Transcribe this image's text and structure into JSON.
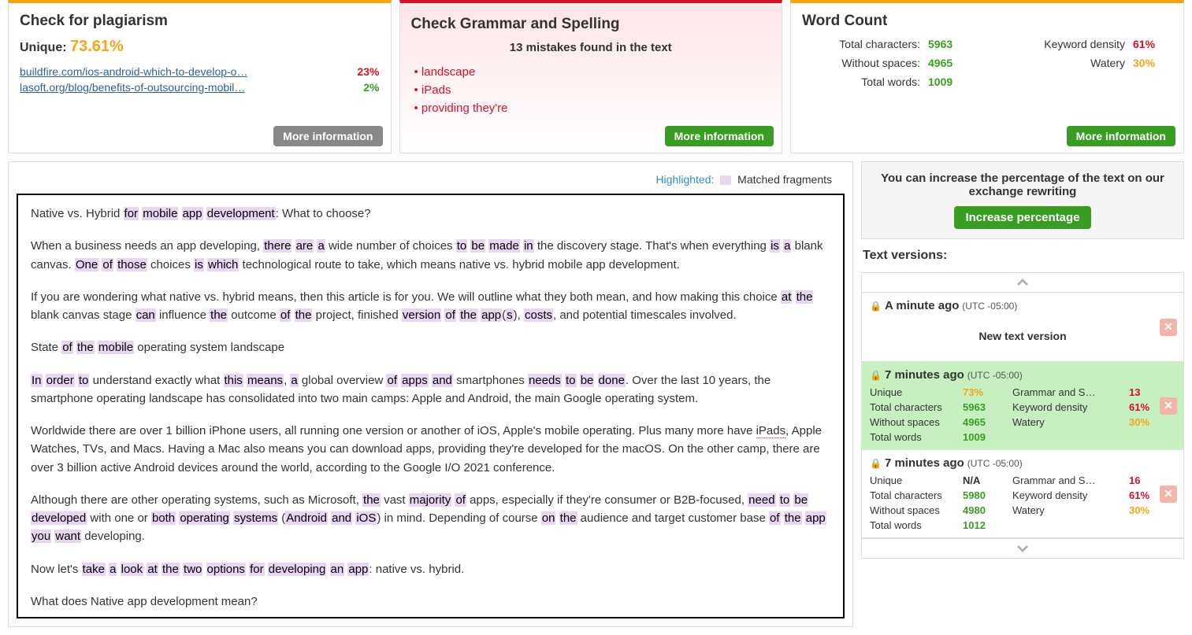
{
  "plagiarism": {
    "title": "Check for plagiarism",
    "unique_label": "Unique:",
    "unique_value": "73.61%",
    "sources": [
      {
        "url": "buildfire.com/ios-android-which-to-develop-o…",
        "pct": "23%",
        "tone": "red"
      },
      {
        "url": "lasoft.org/blog/benefits-of-outsourcing-mobil…",
        "pct": "2%",
        "tone": "green"
      }
    ],
    "more": "More information"
  },
  "grammar": {
    "title": "Check Grammar and Spelling",
    "subtitle": "13 mistakes found in the text",
    "items": [
      "• landscape",
      "• iPads",
      "• providing they're"
    ],
    "more": "More information"
  },
  "wordcount": {
    "title": "Word Count",
    "left": [
      {
        "label": "Total characters:",
        "value": "5963"
      },
      {
        "label": "Without spaces:",
        "value": "4965"
      },
      {
        "label": "Total words:",
        "value": "1009"
      }
    ],
    "right": [
      {
        "label": "Keyword density",
        "value": "61%",
        "tone": "red"
      },
      {
        "label": "Watery",
        "value": "30%",
        "tone": "orange"
      }
    ],
    "more": "More information"
  },
  "legend": {
    "label": "Highlighted:",
    "text": "Matched fragments"
  },
  "editor_html": "<p>Native vs. Hybrid <mark>for</mark> <mark>mobile</mark> <mark>app</mark> <mark>development</mark>: What to choose?</p><p>When a business needs an app developing, <mark>there</mark> <mark>are</mark> <mark>a</mark> wide number of choices <mark>to</mark> <mark>be</mark> <mark>made</mark> <mark>in</mark> the discovery stage. That's when everything <mark>is</mark> <mark>a</mark> blank canvas. <mark>One</mark> <mark>of</mark> <mark>those</mark> choices <mark>is</mark> <mark>which</mark> technological route to take, which means native vs. hybrid mobile app development.</p><p>If you are wondering what native vs. hybrid means, then this article is for you. We will outline what they both mean, and how making this choice <mark>at</mark> <mark>the</mark> blank canvas stage <mark>can</mark> influence <mark>the</mark> outcome <mark>of</mark> <mark>the</mark> project, finished <mark>version</mark> <mark>of</mark> <mark>the</mark> <mark>app</mark>(<mark>s</mark>), <mark>costs</mark>, and potential timescales involved.</p><p>State <mark>of</mark> <mark>the</mark> <mark>mobile</mark> operating system landscape</p><p><mark>In</mark> <mark>order</mark> <mark>to</mark> understand exactly what <mark>this</mark> <mark>means</mark>, <mark>a</mark> global overview <mark>of</mark> <mark>apps</mark> <mark>and</mark> smartphones <mark>needs</mark> <mark>to</mark> <mark>be</mark> <mark>done</mark>. Over the last 10 years, the smartphone operating landscape has consolidated into two main camps: Apple and Android, the main Google operating system.</p><p>Worldwide there are over 1 billion iPhone users, all running one version or another of iOS, Apple's mobile operating.  Plus many more have <span class='err'>iPads</span>, Apple Watches, TVs, and Macs. Having a Mac also means you can download apps, providing they're developed for the macOS. On the other camp, there are over 3 billion active Android devices around the world, according to the Google I/O 2021 conference.</p><p>Although there are other operating systems, such as Microsoft, <mark>the</mark> vast <mark>majority</mark> <mark>of</mark> apps, especially if they're consumer or B2B-focused, <mark>need</mark> <mark>to</mark> <mark>be</mark> <mark>developed</mark> with one or <mark>both</mark> <mark>operating</mark> <mark>systems</mark> (<mark>Android</mark> <mark>and</mark> <mark>iOS</mark>) in mind. Depending of course <mark>on</mark> <mark>the</mark> audience and target customer base <mark>of</mark> <mark>the</mark> <mark>app</mark> <mark>you</mark> <mark>want</mark> developing.</p><p>Now let's <mark>take</mark> <mark>a</mark> <mark>look</mark> <mark>at</mark> <mark>the</mark> <mark>two</mark> <mark>options</mark> <mark>for</mark> <mark>developing</mark> <mark>an</mark> <mark>app</mark>: native vs. hybrid.</p><p>What does Native app development mean?</p>",
  "promo": {
    "text": "You can increase the percentage of the text on our exchange rewriting",
    "button": "Increase percentage"
  },
  "versions_title": "Text versions:",
  "versions": [
    {
      "time": "A minute ago",
      "tz": "(UTC -05:00)",
      "body": "New text version",
      "simple": true
    },
    {
      "time": "7 minutes ago",
      "tz": "(UTC -05:00)",
      "active": true,
      "stats": {
        "unique": "73%",
        "unique_tone": "orange",
        "grammar": "13",
        "grammar_tone": "red",
        "chars": "5963",
        "kd": "61%",
        "kd_tone": "red",
        "nospace": "4965",
        "watery": "30%",
        "watery_tone": "orange",
        "words": "1009"
      }
    },
    {
      "time": "7 minutes ago",
      "tz": "(UTC -05:00)",
      "stats": {
        "unique": "N/A",
        "unique_tone": "",
        "grammar": "16",
        "grammar_tone": "red",
        "chars": "5980",
        "kd": "61%",
        "kd_tone": "red",
        "nospace": "4980",
        "watery": "30%",
        "watery_tone": "orange",
        "words": "1012"
      }
    }
  ],
  "labels": {
    "unique": "Unique",
    "grammar": "Grammar and S…",
    "chars": "Total characters",
    "kd": "Keyword density",
    "nospace": "Without spaces",
    "watery": "Watery",
    "words": "Total words"
  }
}
